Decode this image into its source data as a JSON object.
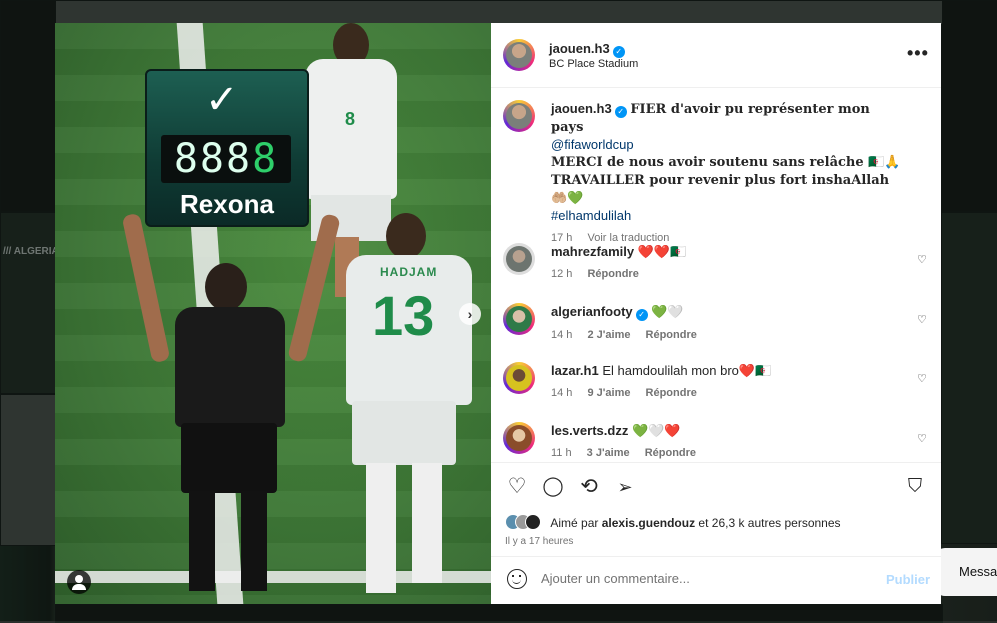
{
  "post": {
    "username": "jaouen.h3",
    "location": "BC Place Stadium",
    "caption_line1": "FIER d'avoir pu représenter mon pays",
    "caption_mention": "@fifaworldcup",
    "caption_line2": "MERCI de nous avoir soutenu sans relâche 🇩🇿🙏",
    "caption_line3": "TRAVAILLER pour revenir plus fort inshaAllah 🤲🏼💚",
    "caption_hashtag": "#elhamdulilah",
    "caption_time": "17 h",
    "translate_label": "Voir la traduction",
    "more_icon": "•••"
  },
  "media": {
    "board_check": "✓",
    "board_digits_dim": "888",
    "board_digits_lit": "8",
    "board_brand": "Rexona",
    "player_name": "HADJAM",
    "player_number": "13",
    "player8_number": "8",
    "next_icon": "›"
  },
  "comments": [
    {
      "user": "mahrezfamily",
      "text": "❤️❤️🇩🇿",
      "time": "12 h",
      "likes": "",
      "reply": "Répondre",
      "verified": false
    },
    {
      "user": "algerianfooty",
      "text": "💚🤍",
      "time": "14 h",
      "likes": "2 J'aime",
      "reply": "Répondre",
      "verified": true
    },
    {
      "user": "lazar.h1",
      "text": "El hamdoulilah mon bro❤️🇩🇿",
      "time": "14 h",
      "likes": "9 J'aime",
      "reply": "Répondre",
      "verified": false
    },
    {
      "user": "les.verts.dzz",
      "text": "💚🤍❤️",
      "time": "11 h",
      "likes": "3 J'aime",
      "reply": "Répondre",
      "verified": false
    }
  ],
  "actions": {
    "like_icon": "♡",
    "comment_icon": "◯",
    "repost_icon": "⟲",
    "share_icon": "➢",
    "save_icon": "⛉",
    "liked_by_prefix": "Aimé par",
    "liked_by_user": "alexis.guendouz",
    "liked_by_suffix": "et 26,3 k autres personnes",
    "posted_time": "Il y a 17 heures"
  },
  "add_comment": {
    "placeholder": "Ajouter un commentaire...",
    "publish_label": "Publier"
  },
  "background": {
    "left_label": "/// ALGERIA",
    "message_pill": "Messa"
  },
  "colors": {
    "accent_blue": "#0095f6",
    "publish_disabled": "#b3dbff",
    "link": "#00376b"
  }
}
